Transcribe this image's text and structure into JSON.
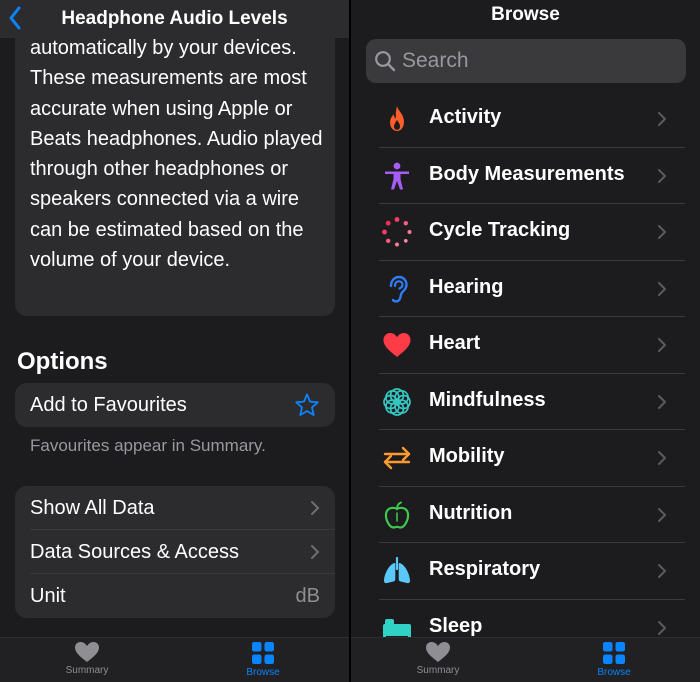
{
  "left": {
    "nav_title": "Headphone Audio Levels",
    "description": "automatically by your devices. These measurements are most accurate when using Apple or Beats headphones. Audio played through other headphones or speakers connected via a wire can be estimated based on the volume of your device.",
    "options_header": "Options",
    "add_favourites_label": "Add to Favourites",
    "favourites_hint": "Favourites appear in Summary.",
    "rows": [
      {
        "label": "Show All Data"
      },
      {
        "label": "Data Sources & Access"
      },
      {
        "label": "Unit",
        "value": "dB"
      }
    ]
  },
  "right": {
    "title": "Browse",
    "search_placeholder": "Search",
    "categories": [
      {
        "label": "Activity",
        "icon": "flame-icon",
        "color": "#ff5e2a"
      },
      {
        "label": "Body Measurements",
        "icon": "person-icon",
        "color": "#a55df5"
      },
      {
        "label": "Cycle Tracking",
        "icon": "cycle-icon",
        "color": "#ff3b6b"
      },
      {
        "label": "Hearing",
        "icon": "ear-icon",
        "color": "#2e7df6"
      },
      {
        "label": "Heart",
        "icon": "heart-icon",
        "color": "#ff3b47"
      },
      {
        "label": "Mindfulness",
        "icon": "flower-icon",
        "color": "#35c6c0"
      },
      {
        "label": "Mobility",
        "icon": "arrows-icon",
        "color": "#ff9a2e"
      },
      {
        "label": "Nutrition",
        "icon": "apple-icon",
        "color": "#3ec94e"
      },
      {
        "label": "Respiratory",
        "icon": "lungs-icon",
        "color": "#5ac8fa"
      },
      {
        "label": "Sleep",
        "icon": "bed-icon",
        "color": "#31d2c6"
      }
    ]
  },
  "tabbar": {
    "summary_label": "Summary",
    "browse_label": "Browse"
  },
  "colors": {
    "accent": "#0a84ff",
    "background": "#1c1c1e",
    "card": "#2c2c2e"
  }
}
